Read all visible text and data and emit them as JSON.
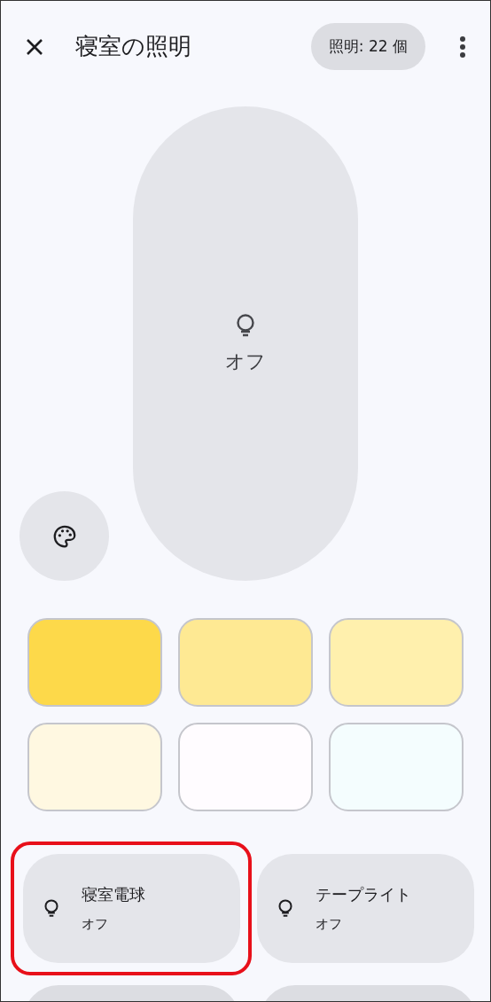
{
  "header": {
    "title": "寝室の照明",
    "count_chip": "照明: 22 個"
  },
  "main_control": {
    "status": "オフ",
    "on": false
  },
  "color_swatches": [
    {
      "color": "#fdd94a"
    },
    {
      "color": "#fee993"
    },
    {
      "color": "#fff0ad"
    },
    {
      "color": "#fff8e1"
    },
    {
      "color": "#fffcff"
    },
    {
      "color": "#f4fdfe"
    }
  ],
  "devices": [
    {
      "name": "寝室電球",
      "status": "オフ",
      "highlighted": true
    },
    {
      "name": "テープライト",
      "status": "オフ",
      "highlighted": false
    }
  ]
}
